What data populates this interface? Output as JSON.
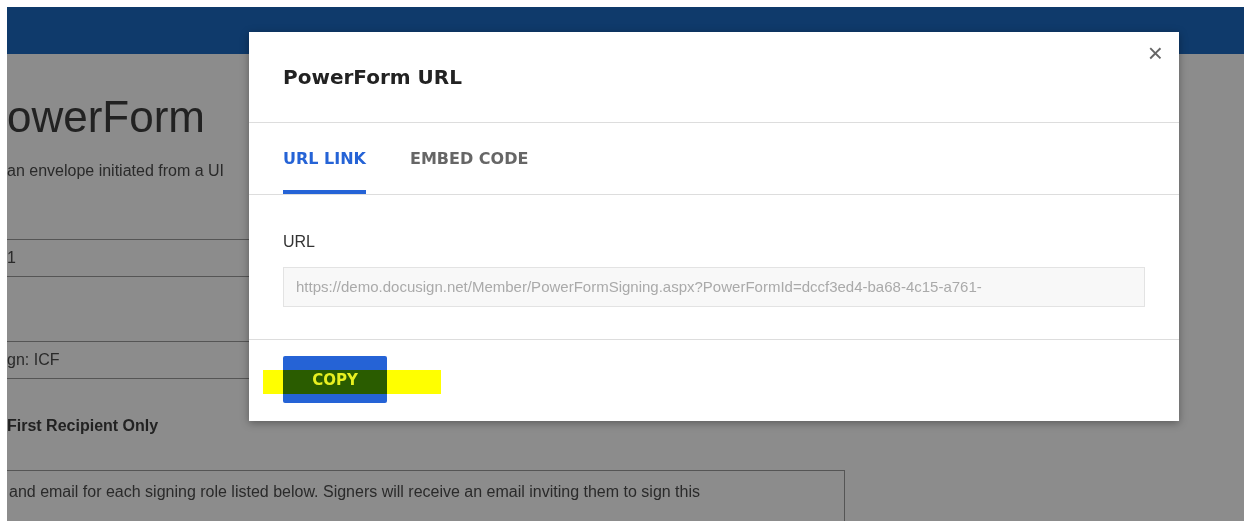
{
  "background_page": {
    "title": "owerForm",
    "description": "an envelope initiated from a UI",
    "field_1": {
      "value": "1"
    },
    "field_2": {
      "value": "gn: ICF"
    },
    "section_heading": "First Recipient Only",
    "instructions": "and email for each signing role listed below. Signers will receive an email inviting them to sign this"
  },
  "dialog": {
    "title": "PowerForm URL",
    "close": "×",
    "tabs": [
      {
        "label": "URL LINK",
        "selected": true
      },
      {
        "label": "EMBED CODE",
        "selected": false
      }
    ],
    "url_field": {
      "label": "URL",
      "value": "https://demo.docusign.net/Member/PowerFormSigning.aspx?PowerFormId=dccf3ed4-ba68-4c15-a761-"
    },
    "buttons": [
      {
        "label": "COPY",
        "highlighted": true
      }
    ]
  }
}
